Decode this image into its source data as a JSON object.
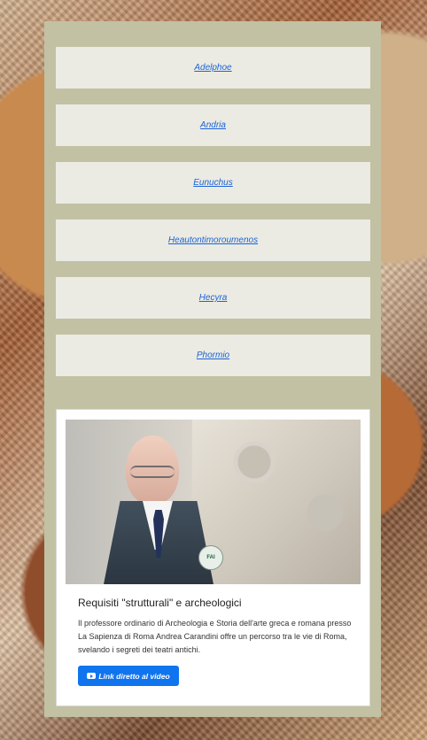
{
  "plays": [
    {
      "label": "Adelphoe"
    },
    {
      "label": "Andria"
    },
    {
      "label": "Eunuchus"
    },
    {
      "label": "Heautontimoroumenos"
    },
    {
      "label": "Hecyra"
    },
    {
      "label": "Phormio"
    }
  ],
  "video": {
    "title": "Requisiti \"strutturali\" e archeologici",
    "description": "Il professore ordinario di Archeologia e Storia dell'arte greca e romana presso La Sapienza di Roma Andrea Carandini offre un percorso tra le vie di Roma, svelando i segreti dei teatri antichi.",
    "button_label": "Link diretto al video",
    "button_icon": "youtube-icon",
    "image_badge_text": "FAI"
  },
  "colors": {
    "panel": "#c2c1a3",
    "link": "#1b63d5",
    "button": "#0f74ee"
  }
}
